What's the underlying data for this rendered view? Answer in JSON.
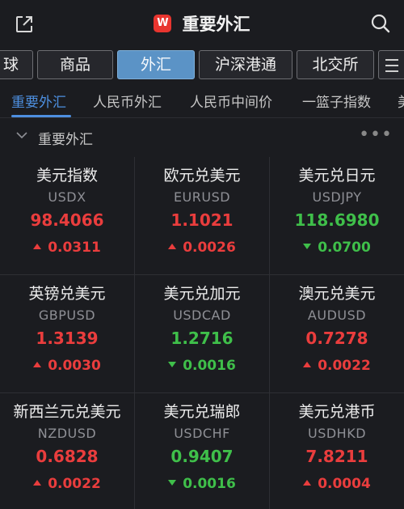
{
  "header": {
    "title": "重要外汇",
    "logo_text": "W",
    "share_icon": "share-icon",
    "search_icon": "search-icon"
  },
  "market_tabs": [
    {
      "label": "球",
      "active": false
    },
    {
      "label": "商品",
      "active": false
    },
    {
      "label": "外汇",
      "active": true
    },
    {
      "label": "沪深港通",
      "active": false
    },
    {
      "label": "北交所",
      "active": false
    }
  ],
  "sub_tabs": [
    {
      "label": "重要外汇",
      "active": true
    },
    {
      "label": "人民币外汇",
      "active": false
    },
    {
      "label": "人民币中间价",
      "active": false
    },
    {
      "label": "一篮子指数",
      "active": false
    },
    {
      "label": "美",
      "active": false
    }
  ],
  "section": {
    "title": "重要外汇",
    "more": "•••"
  },
  "colors": {
    "up": "#ea3d3d",
    "down": "#3fbf4a",
    "accent": "#4d8fe0",
    "active_tab": "#5b93c6"
  },
  "quotes": [
    {
      "name": "美元指数",
      "code": "USDX",
      "price": "98.4066",
      "change": "0.0311",
      "direction": "up"
    },
    {
      "name": "欧元兑美元",
      "code": "EURUSD",
      "price": "1.1021",
      "change": "0.0026",
      "direction": "up"
    },
    {
      "name": "美元兑日元",
      "code": "USDJPY",
      "price": "118.6980",
      "change": "0.0700",
      "direction": "down"
    },
    {
      "name": "英镑兑美元",
      "code": "GBPUSD",
      "price": "1.3139",
      "change": "0.0030",
      "direction": "up"
    },
    {
      "name": "美元兑加元",
      "code": "USDCAD",
      "price": "1.2716",
      "change": "0.0016",
      "direction": "down"
    },
    {
      "name": "澳元兑美元",
      "code": "AUDUSD",
      "price": "0.7278",
      "change": "0.0022",
      "direction": "up"
    },
    {
      "name": "新西兰元兑美元",
      "code": "NZDUSD",
      "price": "0.6828",
      "change": "0.0022",
      "direction": "up"
    },
    {
      "name": "美元兑瑞郎",
      "code": "USDCHF",
      "price": "0.9407",
      "change": "0.0016",
      "direction": "down"
    },
    {
      "name": "美元兑港币",
      "code": "USDHKD",
      "price": "7.8211",
      "change": "0.0004",
      "direction": "up"
    }
  ]
}
